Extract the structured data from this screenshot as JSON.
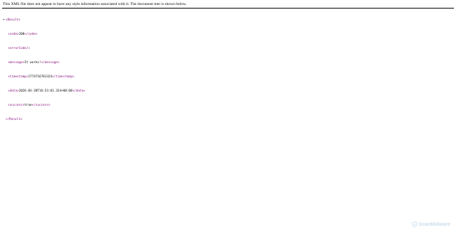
{
  "notice": "This XML file does not appear to have any style information associated with it. The document tree is shown below.",
  "tree": {
    "toggle": "▾",
    "root_open": "<Result>",
    "root_close": "</Result>",
    "code": {
      "open": "<code>",
      "value": "200",
      "close": "</code>"
    },
    "error_code": {
      "tag": "<errorCode/>"
    },
    "message": {
      "open": "<message>",
      "value": "It works!",
      "close": "</message>"
    },
    "timestamp": {
      "open": "<timestamp>",
      "value": "1774716781324",
      "close": "</timestamp>"
    },
    "data": {
      "open": "<data>",
      "value": "2026-03-28T16:53:01.324+08:00",
      "close": "</data>"
    },
    "success": {
      "open": "<success>",
      "value": "true",
      "close": "</success>"
    }
  },
  "watermark": {
    "text": "ScanMalware",
    "icon": "shield-scan-icon",
    "color": "#6aa0c8"
  }
}
